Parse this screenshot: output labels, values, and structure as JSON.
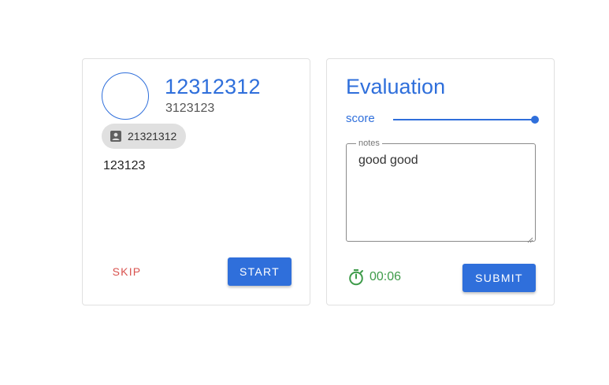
{
  "profile": {
    "title": "12312312",
    "subtitle": "3123123",
    "chip_label": "21321312",
    "chip_icon": "contact-card-icon",
    "description": "123123",
    "skip_label": "SKIP",
    "start_label": "START"
  },
  "evaluation": {
    "title": "Evaluation",
    "slider_label": "score",
    "score_fraction": 1.0,
    "notes_label": "notes",
    "notes_value": "good good",
    "timer_icon": "stopwatch-icon",
    "timer_value": "00:06",
    "submit_label": "SUBMIT"
  },
  "colors": {
    "accent": "#2f6fdb",
    "skip": "#d9534f",
    "timer": "#3e9b4a",
    "chip_bg": "#e0e0e0"
  }
}
